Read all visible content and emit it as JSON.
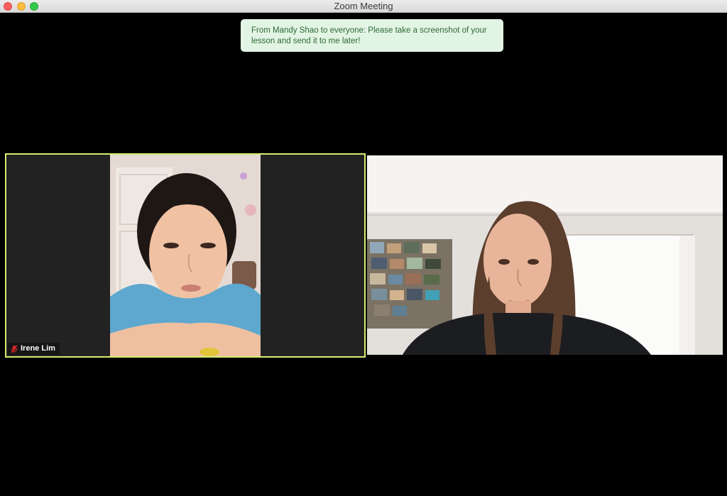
{
  "window": {
    "title": "Zoom Meeting"
  },
  "chat_notification": {
    "line1": "From Mandy Shao to everyone: Please take a screenshot of your",
    "line2": "lesson and send it to me later!"
  },
  "participants": [
    {
      "name": "Irene Lim",
      "muted_icon": "muted-mic-icon",
      "active_speaker": true,
      "accent_color": "#d4ee6e"
    },
    {
      "name": ""
    }
  ],
  "colors": {
    "toast_bg": "#e2f4e4",
    "toast_text": "#2d6a33",
    "active_border": "#d4ee6e",
    "mute_red": "#e02828"
  }
}
